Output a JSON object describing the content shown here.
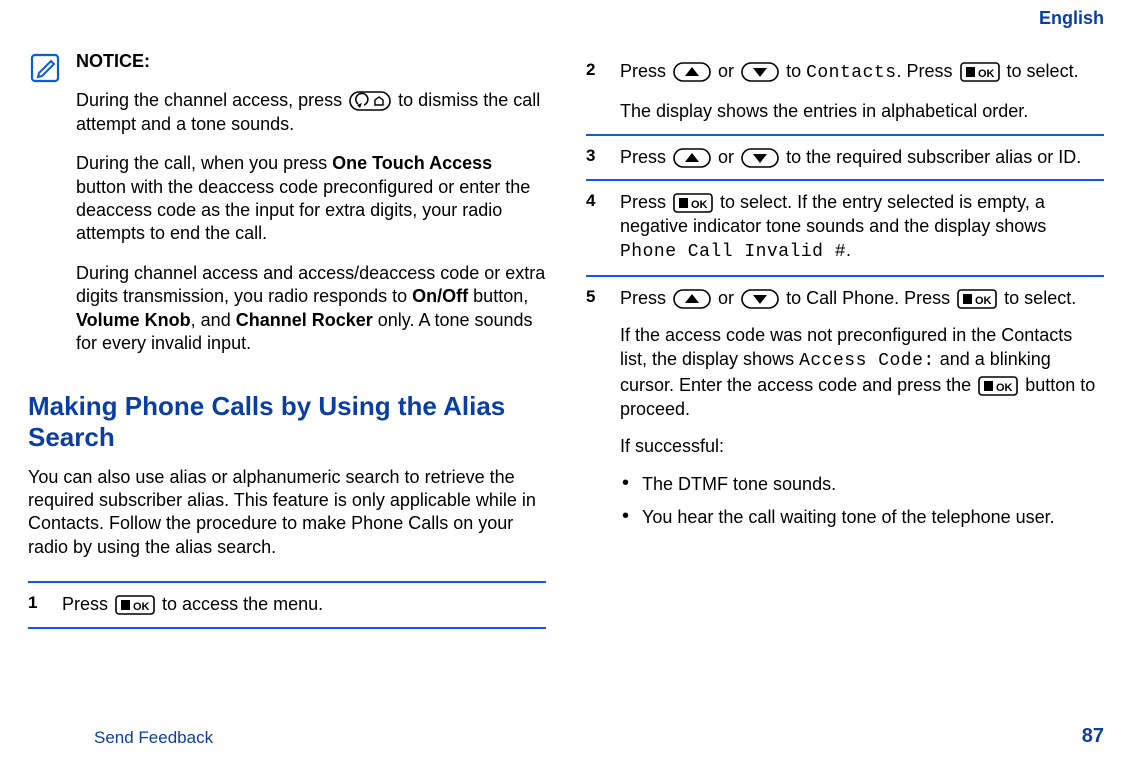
{
  "header": {
    "language": "English"
  },
  "footer": {
    "feedback": "Send Feedback",
    "page_number": "87"
  },
  "notice": {
    "title": "NOTICE:",
    "p1_a": "During the channel access, press ",
    "p1_b": " to dismiss the call attempt and a tone sounds.",
    "p2_a": "During the call, when you press ",
    "p2_bold1": "One Touch Access",
    "p2_b": " button with the deaccess code preconfigured or enter the deaccess code as the input for extra digits, your radio attempts to end the call.",
    "p3_a": "During channel access and access/deaccess code or extra digits transmission, you radio responds to ",
    "p3_bold1": "On/Off",
    "p3_b": " button, ",
    "p3_bold2": "Volume Knob",
    "p3_c": ", and ",
    "p3_bold3": "Channel Rocker",
    "p3_d": " only. A tone sounds for every invalid input."
  },
  "section_title": "Making Phone Calls by Using the Alias Search",
  "section_intro": "You can also use alias or alphanumeric search to retrieve the required subscriber alias. This feature is only applicable while in Contacts. Follow the procedure to make Phone Calls on your radio by using the alias search.",
  "steps": {
    "s1": {
      "n": "1",
      "a": "Press ",
      "b": " to access the menu."
    },
    "s2": {
      "n": "2",
      "a": "Press ",
      "b": " or ",
      "c": " to ",
      "contacts": "Contacts",
      "d": ". Press ",
      "e": " to select.",
      "p2": "The display shows the entries in alphabetical order."
    },
    "s3": {
      "n": "3",
      "a": "Press ",
      "b": " or ",
      "c": " to the required subscriber alias or ID."
    },
    "s4": {
      "n": "4",
      "a": "Press ",
      "b": " to select. If the entry selected is empty, a negative indicator tone sounds and the display shows ",
      "lcd": "Phone Call Invalid #",
      "c": "."
    },
    "s5": {
      "n": "5",
      "a": "Press ",
      "b": " or ",
      "c": " to Call Phone. Press ",
      "d": " to select.",
      "p2a": "If the access code was not preconfigured in the Contacts list, the display shows ",
      "p2lcd": "Access Code:",
      "p2b": " and a blinking cursor. Enter the access code and press the ",
      "p2c": " button to proceed.",
      "p3": "If successful:",
      "b1": "The DTMF tone sounds.",
      "b2": "You hear the call waiting tone of the telephone user."
    }
  }
}
